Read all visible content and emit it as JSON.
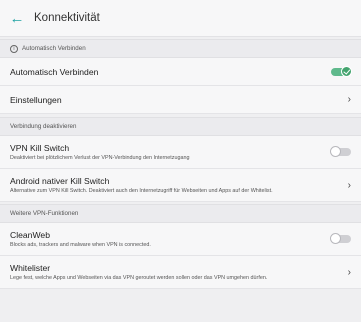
{
  "header": {
    "back_icon": "arrow-left-icon",
    "title": "Konnektivität"
  },
  "section_auto": {
    "label": "Automatisch Verbinden",
    "icon": "info-icon"
  },
  "auto_connect": {
    "label": "Automatisch Verbinden",
    "toggle": "on"
  },
  "settings": {
    "label": "Einstellungen"
  },
  "section_disconnect": {
    "label": "Verbindung deaktivieren"
  },
  "vpn_kill_switch": {
    "label": "VPN Kill Switch",
    "description": "Deaktiviert bei plötzlichem Verlust der VPN-Verbindung den Internetzugang",
    "toggle": "off"
  },
  "android_kill_switch": {
    "label": "Android nativer Kill Switch",
    "description": "Alternative zum VPN Kill Switch. Deaktiviert auch den Internetzugriff für Webseiten und Apps auf der Whitelist."
  },
  "section_more": {
    "label": "Weitere VPN-Funktionen"
  },
  "cleanweb": {
    "label": "CleanWeb",
    "description": "Blocks ads, trackers and malware when VPN is connected.",
    "toggle": "off"
  },
  "whitelister": {
    "label": "Whitelister",
    "description": "Lege fest, welche Apps und Webseiten via das VPN geroutet werden sollen oder das VPN umgehen dürfen."
  },
  "colors": {
    "accent": "#1fa3a3",
    "toggle_on": "#43a36e",
    "background": "#efeff1"
  }
}
